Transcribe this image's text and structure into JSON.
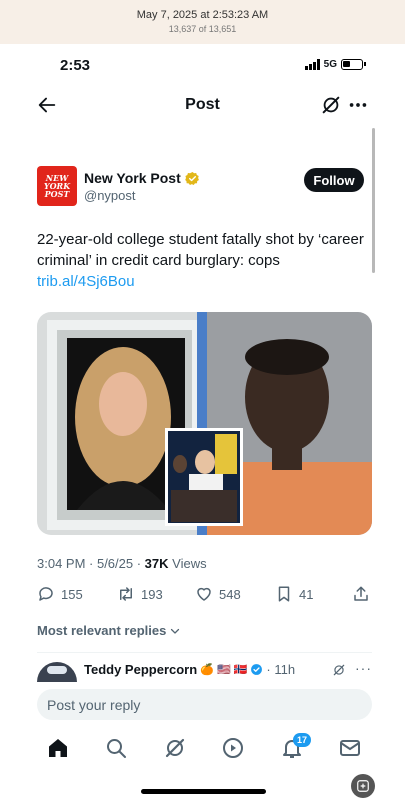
{
  "capture": {
    "date": "May 7, 2025 at 2:53:23 AM",
    "count": "13,637 of 13,651"
  },
  "status_bar": {
    "time": "2:53",
    "network": "5G"
  },
  "nav": {
    "title": "Post"
  },
  "author": {
    "name": "New York Post",
    "handle": "@nypost",
    "logo_text": [
      "NEW",
      "YORK",
      "POST"
    ],
    "follow_label": "Follow",
    "brand_color": "#e1251b"
  },
  "tweet": {
    "text": "22-year-old college student fatally shot by ‘career criminal’ in credit card burglary: cops",
    "link": "trib.al/4Sj6Bou",
    "link_color": "#1d9bf0"
  },
  "meta": {
    "datetime": "3:04 PM · 5/6/25 · ",
    "views_count": "37K",
    "views_label": " Views"
  },
  "actions": {
    "replies": "155",
    "reposts": "193",
    "likes": "548",
    "bookmarks": "41"
  },
  "replies_filter": {
    "label": "Most relevant replies"
  },
  "reply": {
    "name": "Teddy Peppercorn",
    "emojis": "🍊 🇺🇸 🇳🇴",
    "time_ago": "· 11h"
  },
  "reply_input": {
    "placeholder": "Post your reply"
  },
  "tabbar": {
    "items": [
      "home-icon",
      "search-icon",
      "grok-icon",
      "video-icon",
      "notifications-icon",
      "messages-icon"
    ],
    "notifications_badge": "17"
  }
}
